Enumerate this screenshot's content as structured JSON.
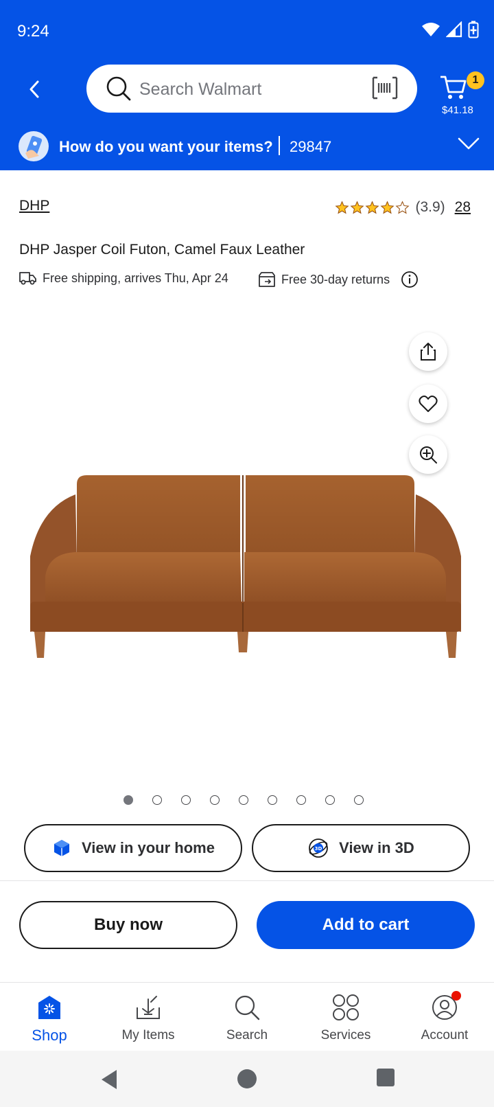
{
  "status_bar": {
    "time": "9:24"
  },
  "header": {
    "search_placeholder": "Search Walmart",
    "cart_count": "1",
    "cart_total": "$41.18",
    "delivery_question": "How do you want your items?",
    "zip": "29847"
  },
  "product": {
    "brand": "DHP",
    "rating_value": "(3.9)",
    "rating_stars": 3.9,
    "review_count": "28",
    "title": "DHP Jasper Coil Futon, Camel Faux Leather",
    "shipping_text": "Free shipping, arrives Thu, Apr 24",
    "returns_text": "Free 30-day returns",
    "image_count": 9,
    "active_image_index": 0
  },
  "view_buttons": {
    "home": "View in your home",
    "three_d": "View in 3D"
  },
  "actions": {
    "buy_now": "Buy now",
    "add_to_cart": "Add to cart"
  },
  "bottom_nav": [
    {
      "label": "Shop",
      "icon": "shop-icon",
      "active": true
    },
    {
      "label": "My Items",
      "icon": "my-items-icon",
      "active": false
    },
    {
      "label": "Search",
      "icon": "search-icon",
      "active": false
    },
    {
      "label": "Services",
      "icon": "services-icon",
      "active": false
    },
    {
      "label": "Account",
      "icon": "account-icon",
      "active": false
    }
  ],
  "colors": {
    "brand_blue": "#0553e6",
    "spark_yellow": "#ffc220",
    "alert_red": "#ea1100",
    "sofa": "#9c5a2e"
  }
}
